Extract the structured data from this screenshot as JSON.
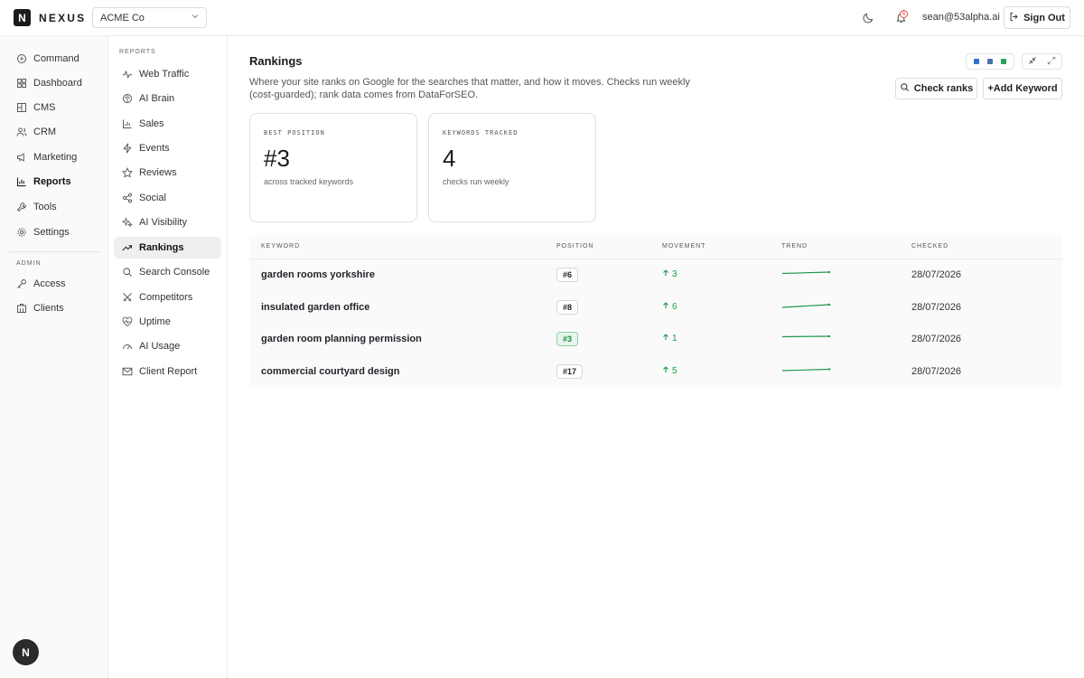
{
  "header": {
    "logo_letter": "N",
    "brand": "NEXUS",
    "org_select": "ACME Co",
    "notifications_count": "6",
    "user_email": "sean@53alpha.ai",
    "sign_out_label": "Sign Out"
  },
  "sidebar": {
    "items": [
      {
        "label": "Command",
        "icon": "command-icon"
      },
      {
        "label": "Dashboard",
        "icon": "dashboard-icon"
      },
      {
        "label": "CMS",
        "icon": "cms-icon"
      },
      {
        "label": "CRM",
        "icon": "users-icon"
      },
      {
        "label": "Marketing",
        "icon": "megaphone-icon"
      },
      {
        "label": "Reports",
        "icon": "bar-chart-icon",
        "active": true
      },
      {
        "label": "Tools",
        "icon": "wrench-icon"
      },
      {
        "label": "Settings",
        "icon": "gear-icon"
      }
    ],
    "admin_section": "ADMIN",
    "admin_items": [
      {
        "label": "Access",
        "icon": "key-icon"
      },
      {
        "label": "Clients",
        "icon": "building-icon"
      }
    ],
    "avatar_letter": "N"
  },
  "subnav": {
    "section_title": "REPORTS",
    "items": [
      {
        "label": "Web Traffic",
        "icon": "activity-icon"
      },
      {
        "label": "AI Brain",
        "icon": "brain-icon"
      },
      {
        "label": "Sales",
        "icon": "bar-chart-icon"
      },
      {
        "label": "Events",
        "icon": "lightning-icon"
      },
      {
        "label": "Reviews",
        "icon": "star-icon"
      },
      {
        "label": "Social",
        "icon": "share-icon"
      },
      {
        "label": "AI Visibility",
        "icon": "sparkle-icon"
      },
      {
        "label": "Rankings",
        "icon": "trending-up-icon",
        "active": true
      },
      {
        "label": "Search Console",
        "icon": "search-icon"
      },
      {
        "label": "Competitors",
        "icon": "swords-icon"
      },
      {
        "label": "Uptime",
        "icon": "heart-pulse-icon"
      },
      {
        "label": "AI Usage",
        "icon": "gauge-icon"
      },
      {
        "label": "Client Report",
        "icon": "mail-icon"
      }
    ]
  },
  "page": {
    "title": "Rankings",
    "description": "Where your site ranks on Google for the searches that matter, and how it moves. Checks run weekly (cost-guarded); rank data comes from DataForSEO.",
    "check_ranks_label": "Check ranks",
    "add_keyword_label": "+Add Keyword",
    "swatch_colors": [
      "#2f6fd6",
      "#4a6fa8",
      "#23a15a"
    ]
  },
  "stats": [
    {
      "label": "BEST POSITION",
      "value": "#3",
      "sub": "across tracked keywords"
    },
    {
      "label": "KEYWORDS TRACKED",
      "value": "4",
      "sub": "checks run weekly"
    }
  ],
  "table": {
    "columns": [
      "KEYWORD",
      "POSITION",
      "MOVEMENT",
      "TREND",
      "CHECKED"
    ],
    "rows": [
      {
        "keyword": "garden rooms yorkshire",
        "position": "#6",
        "movement": "3",
        "checked": "28/07/2026"
      },
      {
        "keyword": "insulated garden office",
        "position": "#8",
        "movement": "6",
        "checked": "28/07/2026"
      },
      {
        "keyword": "garden room planning permission",
        "position": "#3",
        "movement": "1",
        "checked": "28/07/2026"
      },
      {
        "keyword": "commercial courtyard design",
        "position": "#17",
        "movement": "5",
        "checked": "28/07/2026"
      }
    ]
  },
  "colors": {
    "positive": "#1c9a4a",
    "top_position_bg": "#e7f6ec"
  }
}
